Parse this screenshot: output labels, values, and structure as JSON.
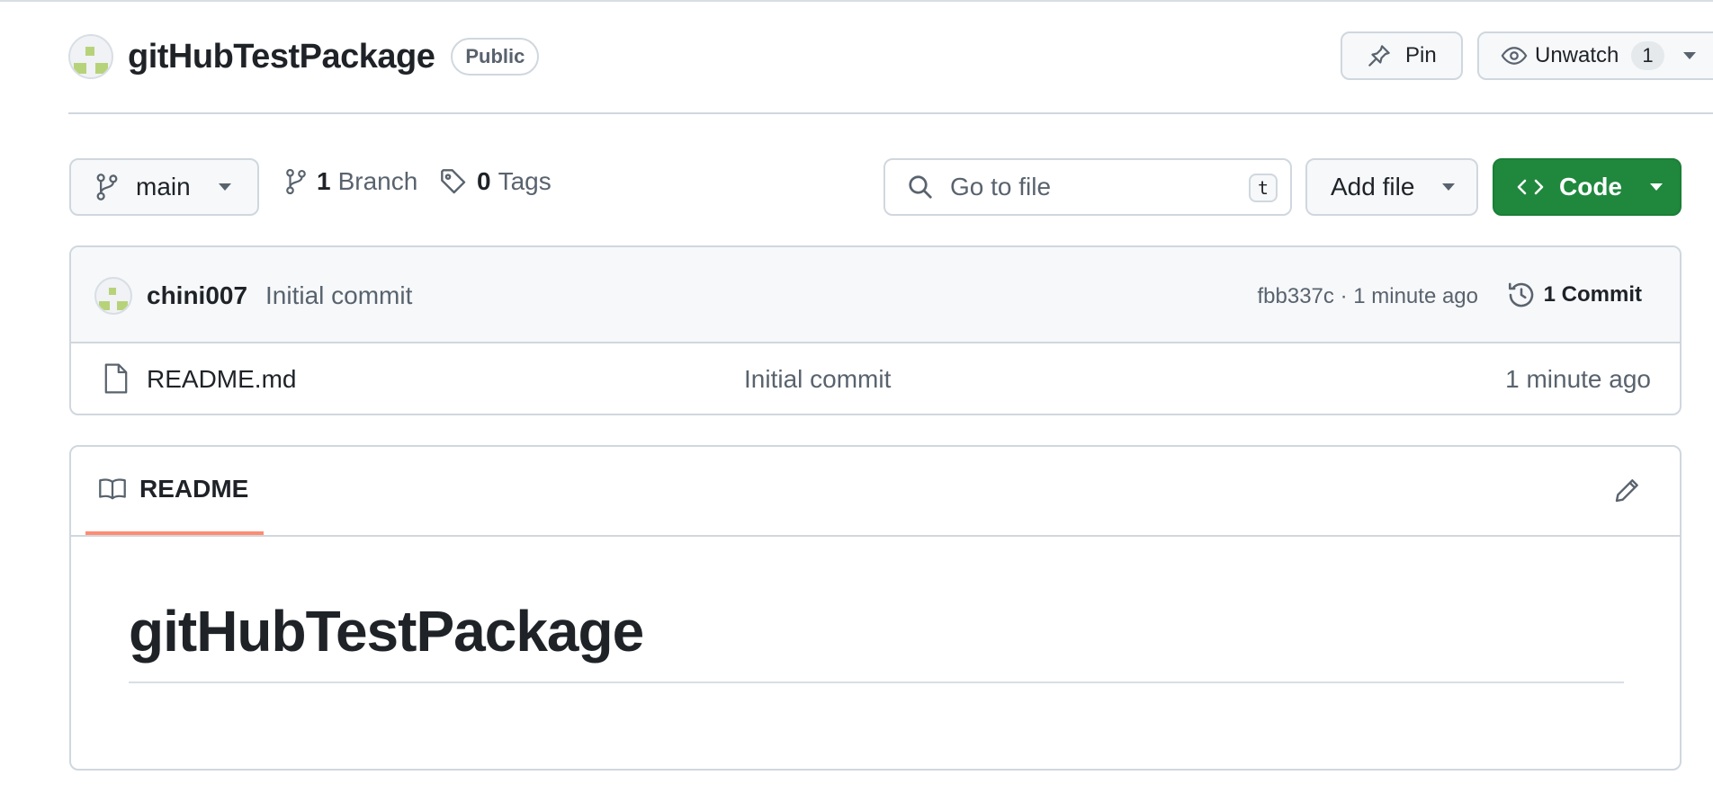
{
  "repo": {
    "name": "gitHubTestPackage",
    "visibility": "Public"
  },
  "actions": {
    "pin_label": "Pin",
    "watch_label": "Unwatch",
    "watch_count": "1"
  },
  "toolbar": {
    "branch": "main",
    "branch_count": "1",
    "branch_label": "Branch",
    "tag_count": "0",
    "tag_label": "Tags",
    "search_placeholder": "Go to file",
    "search_shortcut": "t",
    "add_file_label": "Add file",
    "code_label": "Code"
  },
  "latest_commit": {
    "author": "chini007",
    "message": "Initial commit",
    "sha_time": "fbb337c · 1 minute ago",
    "commits_label": "1 Commit"
  },
  "files": [
    {
      "name": "README.md",
      "commit": "Initial commit",
      "time": "1 minute ago"
    }
  ],
  "readme": {
    "tab_label": "README",
    "heading": "gitHubTestPackage"
  },
  "colors": {
    "code_button": "#1f883d",
    "readme_tab_underline": "#fd8c73",
    "avatar_pattern": "#b7d37a"
  },
  "icons": [
    "pin-icon",
    "eye-icon",
    "chevron-down-icon",
    "git-branch-icon",
    "tag-icon",
    "search-icon",
    "code-icon",
    "history-icon",
    "file-icon",
    "book-icon",
    "pencil-icon"
  ]
}
